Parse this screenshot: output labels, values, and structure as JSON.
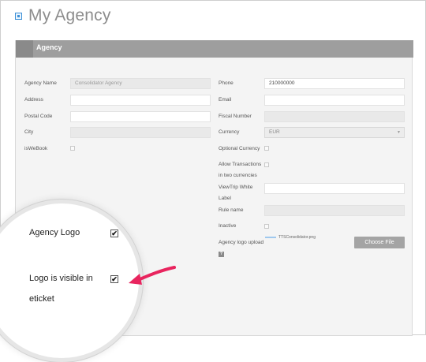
{
  "page": {
    "title": "My Agency"
  },
  "panel": {
    "header": "Agency"
  },
  "left_form": {
    "agency_name_label": "Agency Name",
    "agency_name_value": "Consolidator Agency",
    "address_label": "Address",
    "address_value": "",
    "postal_code_label": "Postal Code",
    "postal_code_value": "",
    "city_label": "City",
    "city_value": "",
    "iswebook_label": "isWeBook",
    "iswebook_checked": false
  },
  "right_form": {
    "phone_label": "Phone",
    "phone_value": "210000000",
    "email_label": "Email",
    "email_value": "",
    "fiscal_number_label": "Fiscal Number",
    "fiscal_number_value": "",
    "currency_label": "Currency",
    "currency_value": "EUR",
    "optional_currency_label": "Optional Currency",
    "optional_currency_checked": false,
    "allow_transactions_label_1": "Allow Transactions",
    "allow_transactions_label_2": "in two currencies",
    "allow_transactions_checked": false,
    "viewtrip_label_1": "ViewTrip White",
    "viewtrip_label_2": "Label",
    "viewtrip_value": "",
    "rule_name_label": "Rule name",
    "rule_name_value": "",
    "inactive_label": "Inactive",
    "inactive_checked": false,
    "logo_upload_label": "Agency logo upload",
    "logo_file_name": "TTSConsolidator.png",
    "choose_file_label": "Choose File",
    "help_icon": "?"
  },
  "magnifier": {
    "agency_logo_label": "Agency Logo",
    "agency_logo_checked": true,
    "logo_visible_label_1": "Logo is visible in",
    "logo_visible_label_2": "eticket",
    "logo_visible_checked": true,
    "check_glyph": "✔"
  },
  "colors": {
    "arrow": "#e8245e",
    "header_bg": "#9e9e9e"
  }
}
